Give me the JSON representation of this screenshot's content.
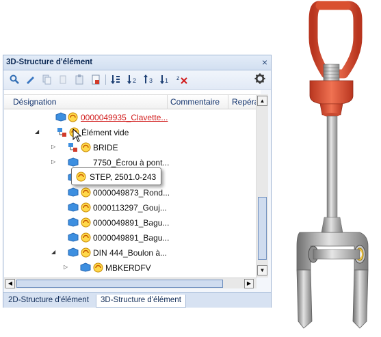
{
  "panel": {
    "title": "3D-Structure d'élément",
    "close_glyph": "×"
  },
  "toolbar": {
    "icons": [
      "search-icon",
      "tool-icon",
      "copy-icon",
      "delete-icon",
      "paste-icon",
      "document-icon",
      "sort-icon",
      "sort-down-icon",
      "sort-up-icon",
      "sort-alpha-icon",
      "filter-clear-icon",
      "gear-icon"
    ]
  },
  "columns": [
    "Désignation",
    "Commentaire",
    "Repéra"
  ],
  "rows": [
    {
      "label": "0000049935_Clavette..."
    },
    {
      "label": "Élément vide"
    },
    {
      "label": "BRIDE"
    },
    {
      "label": "7750_Écrou à pont..."
    },
    {
      "label": "STEP, 2501.0-243"
    },
    {
      "label": "0000049873_Rond..."
    },
    {
      "label": "0000113297_Gouj..."
    },
    {
      "label": "0000049891_Bagu..."
    },
    {
      "label": "0000049891_Bagu..."
    },
    {
      "label": "DIN 444_Boulon à..."
    },
    {
      "label": "MBKERDFV"
    }
  ],
  "tooltip": {
    "text": "STEP, 2501.0-243"
  },
  "tabs": [
    "2D-Structure d'élément",
    "3D-Structure d'élément"
  ],
  "colors": {
    "accent": "#d11a1a",
    "part_blue": "#3d8fe0",
    "ring_red": "#e0533a"
  }
}
